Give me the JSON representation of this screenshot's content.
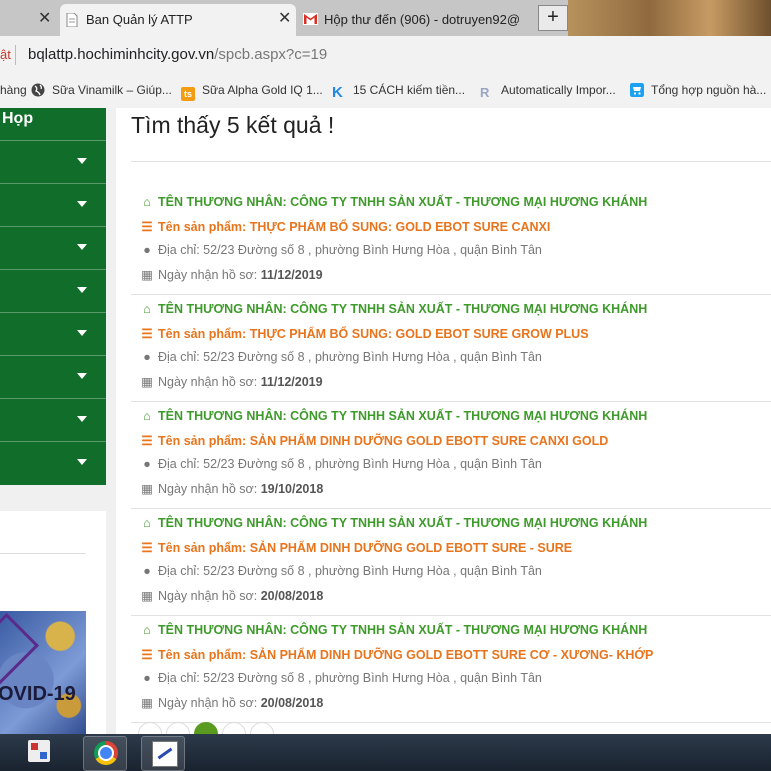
{
  "browser": {
    "tabs": [
      {
        "title": "",
        "close": "✕"
      },
      {
        "title": "Ban Quản lý ATTP",
        "close": "✕"
      },
      {
        "title": "Hộp thư đến (906) - dotruyen92@",
        "close": ""
      }
    ],
    "new_tab_label": "+",
    "address": {
      "prefix": "ật",
      "host": "bqlattp.hochiminhcity.gov.vn",
      "path": "/spcb.aspx?c=19"
    },
    "bookmarks": [
      {
        "label": "hàng",
        "icon": "none"
      },
      {
        "label": "Sữa Vinamilk – Giúp...",
        "icon": "globe-icon",
        "color": "#444444"
      },
      {
        "label": "Sữa Alpha Gold IQ 1...",
        "icon": "ts-icon",
        "color": "#f39c12"
      },
      {
        "label": "15 CÁCH kiếm tiền...",
        "icon": "k-icon",
        "color": "#1e88e5"
      },
      {
        "label": "Automatically Impor...",
        "icon": "kr-icon",
        "color": "#9aa7c4"
      },
      {
        "label": "Tổng hợp nguồn hà...",
        "icon": "cart-icon",
        "color": "#1da1f2"
      }
    ]
  },
  "sidebar": {
    "heading": "Họp",
    "item_count": 8,
    "banner_text": "OVID-19",
    "colors": {
      "bg": "#116d2a"
    }
  },
  "results": {
    "heading": "Tìm thấy 5 kết quả !",
    "labels": {
      "merchant": "TÊN THƯƠNG NHÂN:",
      "product": "Tên sản phẩm:",
      "address": "Địa chỉ:",
      "date": "Ngày nhận hồ sơ:"
    },
    "items": [
      {
        "merchant": "CÔNG TY TNHH SẢN XUẤT - THƯƠNG MẠI HƯƠNG KHÁNH",
        "product": "THỰC PHẨM BỔ SUNG: GOLD EBOT SURE CANXI",
        "address": "52/23 Đường số 8 , phường Bình Hưng Hòa , quận Bình Tân",
        "date": "11/12/2019"
      },
      {
        "merchant": "CÔNG TY TNHH SẢN XUẤT - THƯƠNG MẠI HƯƠNG KHÁNH",
        "product": "THỰC PHẨM BỔ SUNG: GOLD EBOT SURE GROW PLUS",
        "address": "52/23 Đường số 8 , phường Bình Hưng Hòa , quận Bình Tân",
        "date": "11/12/2019"
      },
      {
        "merchant": "CÔNG TY TNHH SẢN XUẤT - THƯƠNG MẠI HƯƠNG KHÁNH",
        "product": "SẢN PHẨM DINH DƯỠNG GOLD EBOTT SURE CANXI GOLD",
        "address": "52/23 Đường số 8 , phường Bình Hưng Hòa , quận Bình Tân",
        "date": "19/10/2018"
      },
      {
        "merchant": "CÔNG TY TNHH SẢN XUẤT - THƯƠNG MẠI HƯƠNG KHÁNH",
        "product": "SẢN PHẨM DINH DƯỠNG GOLD EBOTT SURE - SURE",
        "address": "52/23 Đường số 8 , phường Bình Hưng Hòa , quận Bình Tân",
        "date": "20/08/2018"
      },
      {
        "merchant": "CÔNG TY TNHH SẢN XUẤT - THƯƠNG MẠI HƯƠNG KHÁNH",
        "product": "SẢN PHẨM DINH DƯỠNG GOLD EBOTT SURE CƠ - XƯƠNG- KHỚP",
        "address": "52/23 Đường số 8 , phường Bình Hưng Hòa , quận Bình Tân",
        "date": "20/08/2018"
      }
    ],
    "colors": {
      "merchant": "#3e9b2b",
      "product": "#e8741c",
      "meta": "#777777"
    }
  },
  "pagination": {
    "pages": 5,
    "active_index": 2
  },
  "taskbar": {
    "apps": [
      {
        "name": "ime-icon"
      },
      {
        "name": "chrome-icon"
      },
      {
        "name": "paint-icon"
      }
    ]
  }
}
